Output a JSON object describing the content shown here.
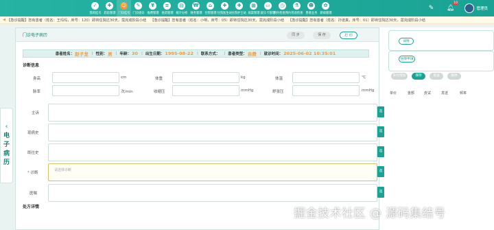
{
  "nav": {
    "items": [
      {
        "label": "我的挂号",
        "glyph": "✓"
      },
      {
        "label": "药房管理",
        "glyph": "✚"
      },
      {
        "label": "门诊挂号",
        "glyph": "☺",
        "active": true
      },
      {
        "label": "门诊接诊",
        "glyph": "✎"
      },
      {
        "label": "收费管理",
        "glyph": "¥"
      },
      {
        "label": "进药管理",
        "glyph": "≡"
      },
      {
        "label": "统计分析",
        "glyph": "▤"
      },
      {
        "label": "财务管理",
        "glyph": "₩"
      },
      {
        "label": "住院管理",
        "glyph": "⌂"
      },
      {
        "label": "住院医生站",
        "glyph": "✚"
      },
      {
        "label": "住院护士站",
        "glyph": "✚"
      },
      {
        "label": "病案管理",
        "glyph": "▦"
      },
      {
        "label": "就诊卡管理",
        "glyph": "▭"
      },
      {
        "label": "预约检查预约",
        "glyph": "◷"
      },
      {
        "label": "检验检查",
        "glyph": "⚗"
      },
      {
        "label": "患者业务",
        "glyph": "☻"
      },
      {
        "label": "新病管理",
        "glyph": "✿"
      }
    ],
    "bell_count": "10",
    "user_name": "管理员"
  },
  "ticker": [
    "【急诊提醒】您有患者（姓名：王玛玛，床号：120）即将住院达30天，需完成阶段小结",
    "【急诊提醒】您有患者（姓名：小明，床号：05）即将住院达30天，需完成阶段小结",
    "【急诊提醒】您有患者（姓名：孙道真，床号：01）即将住院达30天，需完成阶段小结"
  ],
  "left_tab": {
    "label": "电子病历"
  },
  "modal": {
    "title": "门诊电子病历",
    "btn_sync": "同 步",
    "btn_save": "保 存",
    "btn_print": "打 印"
  },
  "patient": {
    "name_label": "患者姓名：",
    "name": "赵子龙",
    "gender_label": "性别：",
    "gender": "男",
    "age_label": "年龄：",
    "age": "30",
    "dob_label": "出生日期：",
    "dob": "1995-08-22",
    "contact_label": "联系方式：",
    "contact": "",
    "type_label": "患者类型：",
    "type": "自费",
    "time_label": "就诊时间：",
    "time": "2025-06-02 10:35:01"
  },
  "diagnosis": {
    "section_title": "诊断信息",
    "height_label": "身高",
    "height_unit": "cm",
    "weight_label": "体重",
    "weight_unit": "kg",
    "temp_label": "体温",
    "temp_unit": "℃",
    "pulse_label": "脉率",
    "pulse_unit": "次/min",
    "sbp_label": "收缩压",
    "sbp_unit": "mmHg",
    "dbp_label": "舒张压",
    "dbp_unit": "mmHg",
    "complaint_label": "主诉",
    "present_label": "现病史",
    "past_label": "既往史",
    "diag_label": "诊断",
    "diag_placeholder": "请选择诊断",
    "advice_label": "医嘱",
    "side_btn": "选"
  },
  "prescription": {
    "section_title": "处方详情"
  },
  "bg": {
    "card1_btn": "详情",
    "card2_btn": "住院申请",
    "tabs": [
      "未付增加",
      "保存",
      "发送",
      "删除"
    ],
    "col_heads": [
      "单价",
      "金额",
      "皮试",
      "发送",
      "频率"
    ]
  },
  "watermark": "掘金技术社区 @ 源码集结号"
}
